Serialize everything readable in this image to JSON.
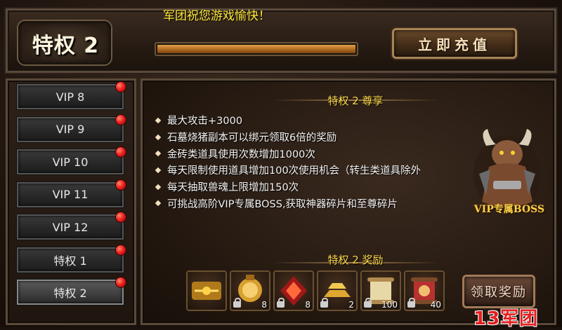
{
  "header": {
    "title": "特权 2",
    "greeting": "军团祝您游戏愉快！",
    "progress_fraction": 1.0,
    "recharge_label": "立即充值"
  },
  "sidebar": {
    "items": [
      {
        "label": "VIP 8",
        "badge": true
      },
      {
        "label": "VIP 9",
        "badge": true
      },
      {
        "label": "VIP 10",
        "badge": true
      },
      {
        "label": "VIP 11",
        "badge": true
      },
      {
        "label": "VIP 12",
        "badge": true
      },
      {
        "label": "特权 1",
        "badge": true
      },
      {
        "label": "特权 2",
        "badge": true,
        "active": true
      }
    ]
  },
  "main": {
    "benefits_title": "特权 2 尊享",
    "benefits": [
      "最大攻击+3000",
      "石墓烧猪副本可以绑元领取6倍的奖励",
      "金砖类道具使用次数增加1000次",
      "每天限制使用道具增加100次使用机会（转生类道具除外",
      "每天抽取兽魂上限增加150次",
      "可挑战高阶VIP专属BOSS,获取神器碎片和至尊碎片"
    ],
    "boss_label": "VIP专属BOSS",
    "rewards_title": "特权 2 奖励",
    "rewards": [
      {
        "icon": "title-badge-icon",
        "count": ""
      },
      {
        "icon": "gold-medal-icon",
        "count": "8"
      },
      {
        "icon": "red-rune-icon",
        "count": "8"
      },
      {
        "icon": "gold-bars-icon",
        "count": "2"
      },
      {
        "icon": "scroll-icon",
        "count": "100"
      },
      {
        "icon": "red-scroll-icon",
        "count": "40"
      }
    ],
    "claim_label": "领取奖励"
  },
  "watermark": "13军团",
  "colors": {
    "accent_yellow": "#ffd94a",
    "button_border": "#a98456",
    "badge_red": "#e22222"
  }
}
